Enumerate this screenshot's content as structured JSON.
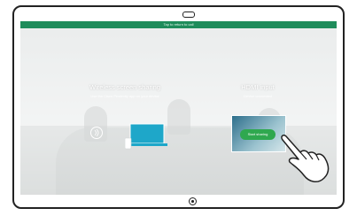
{
  "banner": {
    "text": "Tap to return to call"
  },
  "wireless": {
    "title": "Wireless screen sharing",
    "subtitle": "Use the Cisco Proximity app on your device"
  },
  "hdmi": {
    "title": "HDMI input",
    "subtitle": "Device connected",
    "button_label": "Start sharing"
  },
  "colors": {
    "banner_green": "#1f8c5b",
    "button_green": "#2fa84f",
    "laptop_blue": "#1ea7c9"
  },
  "icons": [
    "camera-icon",
    "proximity-icon",
    "laptop-icon",
    "hand-pointer-icon",
    "home-button-icon"
  ]
}
